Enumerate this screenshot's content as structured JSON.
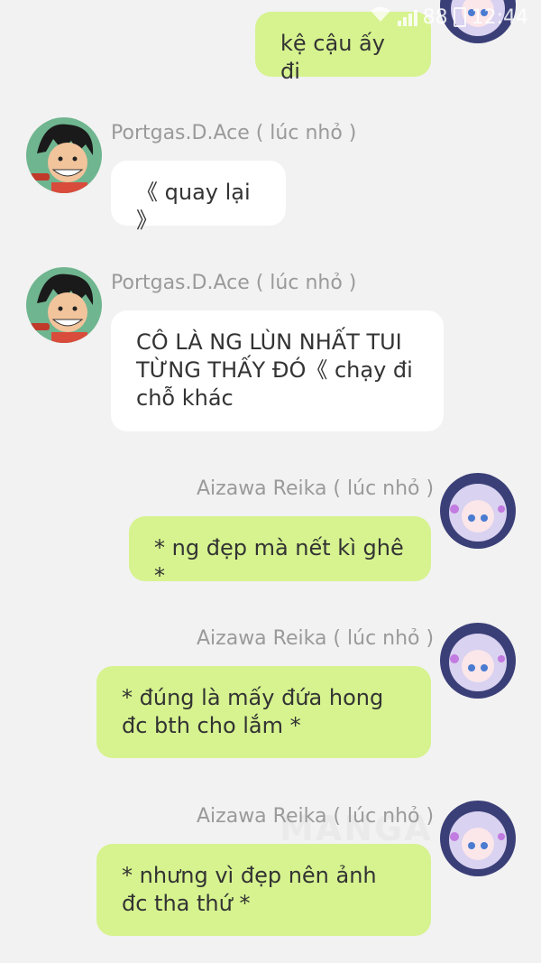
{
  "status": {
    "battery_pct": "88",
    "time": "12:44"
  },
  "messages": [
    {
      "sender": "",
      "text": "kệ cậu ấy đi",
      "side": "out"
    },
    {
      "sender": "Portgas.D.Ace ( lúc nhỏ )",
      "text": "《 quay lại 》",
      "side": "in"
    },
    {
      "sender": "Portgas.D.Ace ( lúc nhỏ )",
      "text": "CÔ LÀ NG LÙN NHẤT TUI TỪNG THẤY ĐÓ《 chạy đi chỗ khác",
      "side": "in"
    },
    {
      "sender": "Aizawa Reika ( lúc nhỏ )",
      "text": "* ng đẹp mà nết kì ghê *",
      "side": "out"
    },
    {
      "sender": "Aizawa Reika ( lúc nhỏ )",
      "text": "* đúng là mấy đứa hong đc bth cho lắm *",
      "side": "out"
    },
    {
      "sender": "Aizawa Reika ( lúc nhỏ )",
      "text": "* nhưng vì đẹp nên ảnh đc tha thứ *",
      "side": "out"
    }
  ],
  "watermark": "MANGA",
  "colors": {
    "out_bubble": "#d6f38f",
    "in_bubble": "#ffffff",
    "background": "#f2f2f2",
    "sender_text": "#9a9a9a"
  },
  "icons": {
    "ace_avatar": "avatar-boy-icon",
    "reika_avatar": "avatar-girl-icon",
    "wifi": "wifi-icon",
    "battery": "battery-icon"
  }
}
